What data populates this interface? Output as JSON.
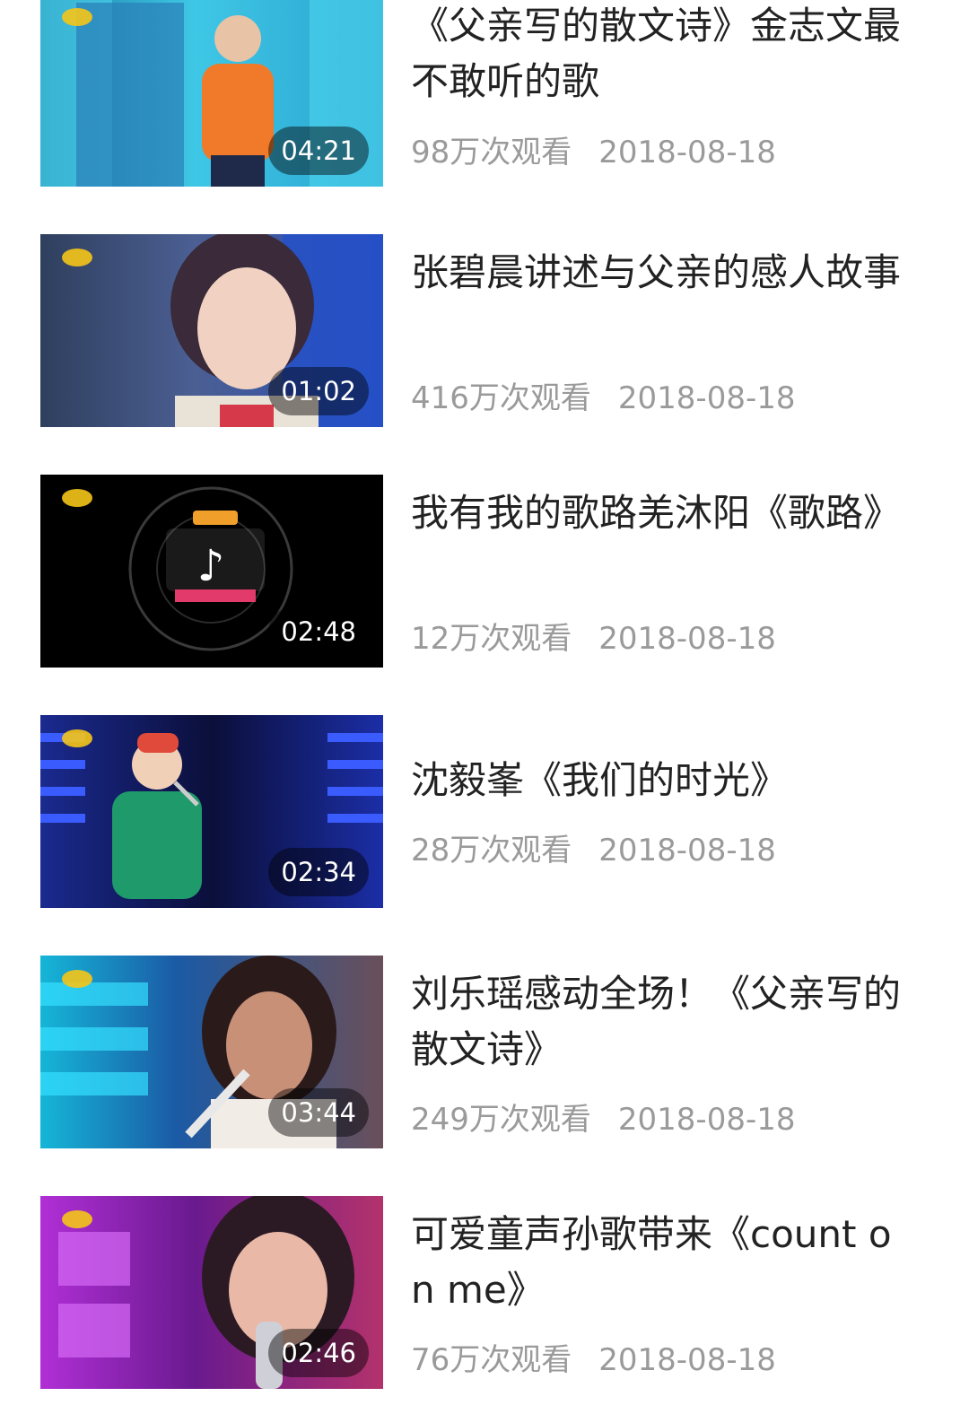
{
  "videos": [
    {
      "title": "《父亲写的散文诗》金志文最不敢听的歌",
      "duration": "04:21",
      "views": "98万次观看",
      "date": "2018-08-18"
    },
    {
      "title": "张碧晨讲述与父亲的感人故事",
      "duration": "01:02",
      "views": "416万次观看",
      "date": "2018-08-18"
    },
    {
      "title": "我有我的歌路羌沐阳《歌路》",
      "duration": "02:48",
      "views": "12万次观看",
      "date": "2018-08-18"
    },
    {
      "title": "沈毅峯《我们的时光》",
      "duration": "02:34",
      "views": "28万次观看",
      "date": "2018-08-18"
    },
    {
      "title": "刘乐瑶感动全场！《父亲写的散文诗》",
      "duration": "03:44",
      "views": "249万次观看",
      "date": "2018-08-18"
    },
    {
      "title": "可爱童声孙歌带来《count on me》",
      "duration": "02:46",
      "views": "76万次观看",
      "date": "2018-08-18"
    }
  ]
}
